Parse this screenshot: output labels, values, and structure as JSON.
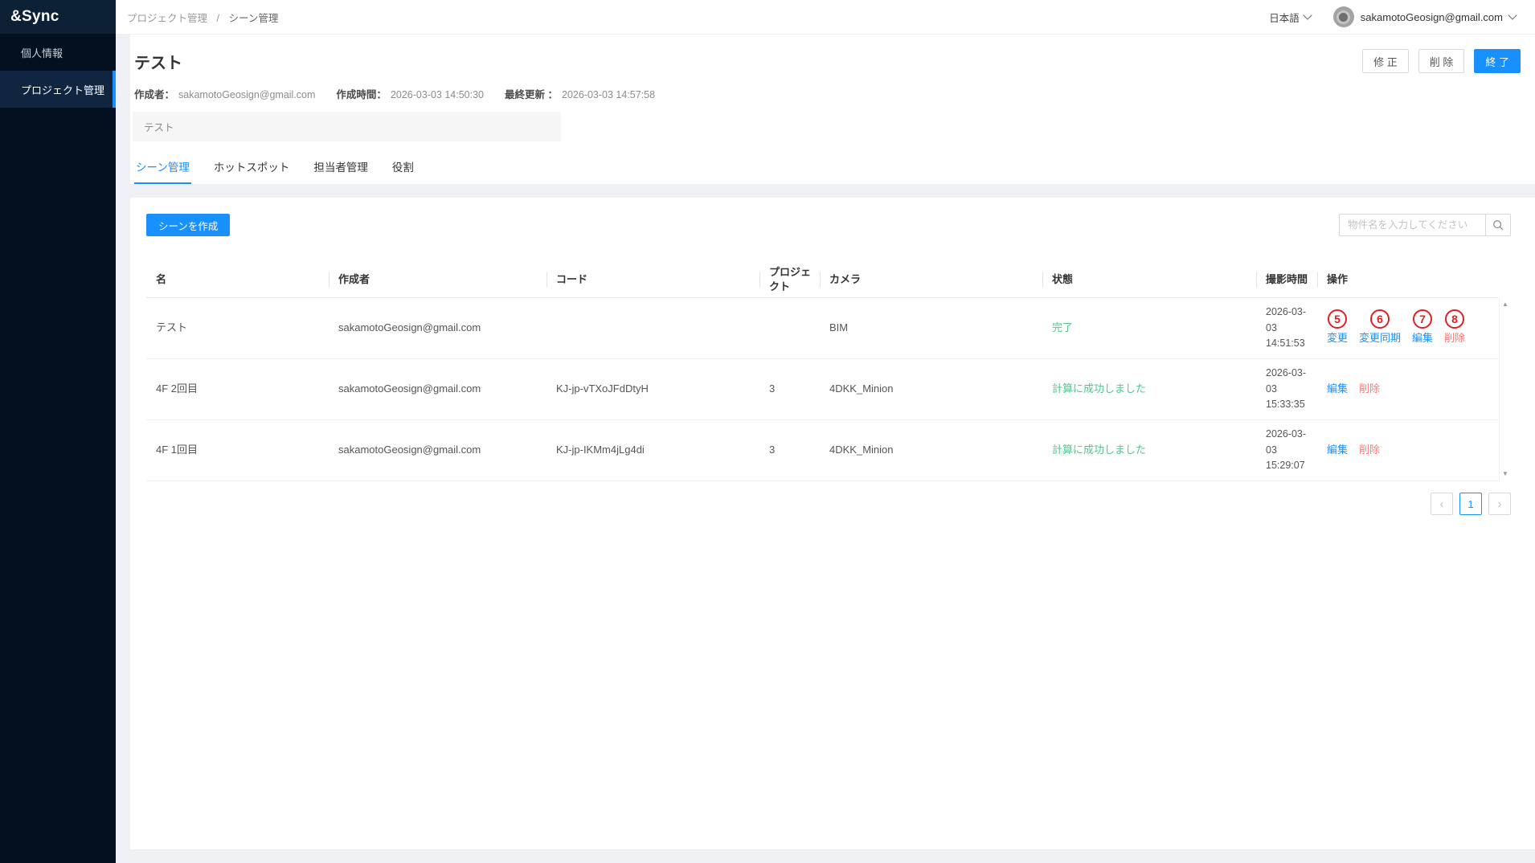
{
  "app": {
    "logo": "&Sync"
  },
  "sidebar": {
    "items": [
      {
        "label": "個人情報",
        "active": false
      },
      {
        "label": "プロジェクト管理",
        "active": true
      }
    ]
  },
  "header": {
    "breadcrumb": [
      "プロジェクト管理",
      "シーン管理"
    ],
    "breadcrumb_separator": "/",
    "language": "日本語",
    "account_email": "sakamotoGeosign@gmail.com"
  },
  "project": {
    "title": "テスト",
    "meta": {
      "creator_label": "作成者：",
      "creator": "sakamotoGeosign@gmail.com",
      "created_label": "作成時間：",
      "created": "2026-03-03 14:50:30",
      "updated_label": "最終更新 ：",
      "updated": "2026-03-03 14:57:58"
    },
    "description": "テスト",
    "actions": {
      "modify": "修 正",
      "delete": "削 除",
      "finish": "終 了"
    }
  },
  "tabs": [
    {
      "label": "シーン管理",
      "active": true
    },
    {
      "label": "ホットスポット",
      "active": false
    },
    {
      "label": "担当者管理",
      "active": false
    },
    {
      "label": "役割",
      "active": false
    }
  ],
  "toolbar": {
    "create_button": "シーンを作成",
    "search_placeholder": "物件名を入力してください"
  },
  "table": {
    "columns": [
      "名",
      "作成者",
      "コード",
      "プロジェクト",
      "カメラ",
      "状態",
      "撮影時間",
      "操作"
    ],
    "rows": [
      {
        "name": "テスト",
        "creator": "sakamotoGeosign@gmail.com",
        "code": "",
        "project": "",
        "camera": "BIM",
        "status": "完了",
        "time": "2026-03-03 14:51:53",
        "actions": [
          {
            "label": "変更",
            "color": "blue",
            "badge": "5"
          },
          {
            "label": "変更同期",
            "color": "blue",
            "badge": "6"
          },
          {
            "label": "編集",
            "color": "blue",
            "badge": "7"
          },
          {
            "label": "削除",
            "color": "red",
            "badge": "8"
          }
        ]
      },
      {
        "name": "4F 2回目",
        "creator": "sakamotoGeosign@gmail.com",
        "code": "KJ-jp-vTXoJFdDtyH",
        "project": "3",
        "camera": "4DKK_Minion",
        "status": "計算に成功しました",
        "time": "2026-03-03 15:33:35",
        "actions": [
          {
            "label": "編集",
            "color": "blue"
          },
          {
            "label": "削除",
            "color": "red"
          }
        ]
      },
      {
        "name": "4F 1回目",
        "creator": "sakamotoGeosign@gmail.com",
        "code": "KJ-jp-IKMm4jLg4di",
        "project": "3",
        "camera": "4DKK_Minion",
        "status": "計算に成功しました",
        "time": "2026-03-03 15:29:07",
        "actions": [
          {
            "label": "編集",
            "color": "blue"
          },
          {
            "label": "削除",
            "color": "red"
          }
        ]
      }
    ]
  },
  "icons": {
    "scroll_up": "▲",
    "scroll_down": "▼"
  },
  "pagination": {
    "prev": "‹",
    "current": "1",
    "next": "›"
  },
  "colors": {
    "primary": "#1890ff",
    "link": "#1890ff",
    "danger": "#ff7875",
    "success": "#53c68c",
    "annotation": "#e02020"
  }
}
